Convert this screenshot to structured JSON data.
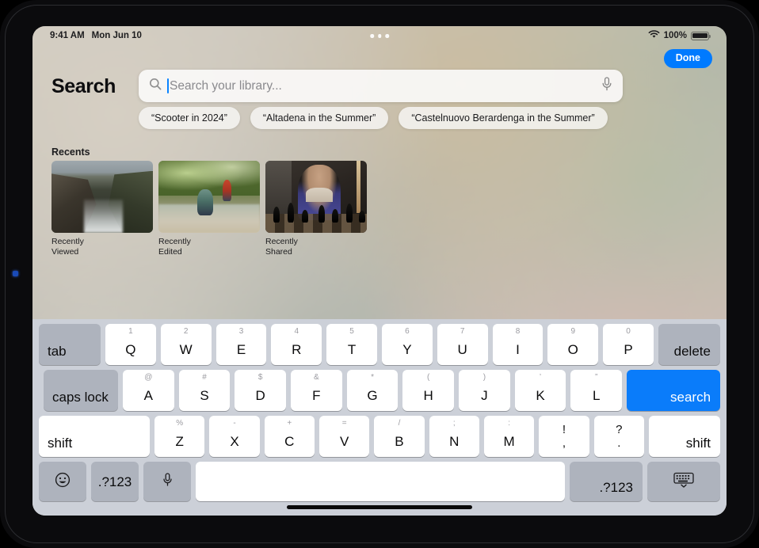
{
  "status_bar": {
    "time": "9:41 AM",
    "date": "Mon Jun 10",
    "battery_percent": "100%",
    "wifi_icon": "wifi-icon",
    "battery_icon": "battery-icon",
    "multitask_icon": "multitasking-dots-icon"
  },
  "header": {
    "title": "Search",
    "done_label": "Done"
  },
  "search": {
    "placeholder": "Search your library...",
    "value": "",
    "search_icon": "search-icon",
    "mic_icon": "microphone-icon"
  },
  "suggestions": [
    {
      "label": "“Scooter in 2024”"
    },
    {
      "label": "“Altadena in the Summer”"
    },
    {
      "label": "“Castelnuovo Berardenga in the Summer”"
    }
  ],
  "recents": {
    "section_title": "Recents",
    "items": [
      {
        "caption": "Recently Viewed",
        "thumb": "coastal-cliffs-photo"
      },
      {
        "caption": "Recently Edited",
        "thumb": "stream-hikers-photo"
      },
      {
        "caption": "Recently Shared",
        "thumb": "chess-player-photo"
      }
    ]
  },
  "keyboard": {
    "row1": [
      {
        "main": "tab",
        "sup": "",
        "style": "dark",
        "size": "k-tab",
        "align": "label-bl"
      },
      {
        "main": "Q",
        "sup": "1"
      },
      {
        "main": "W",
        "sup": "2"
      },
      {
        "main": "E",
        "sup": "3"
      },
      {
        "main": "R",
        "sup": "4"
      },
      {
        "main": "T",
        "sup": "5"
      },
      {
        "main": "Y",
        "sup": "6"
      },
      {
        "main": "U",
        "sup": "7"
      },
      {
        "main": "I",
        "sup": "8"
      },
      {
        "main": "O",
        "sup": "9"
      },
      {
        "main": "P",
        "sup": "0"
      },
      {
        "main": "delete",
        "sup": "",
        "style": "dark",
        "size": "k-del",
        "align": "label-br"
      }
    ],
    "row2": [
      {
        "main": "caps lock",
        "sup": "",
        "style": "dark",
        "size": "k-caps",
        "align": "label-bl"
      },
      {
        "main": "A",
        "sup": "@"
      },
      {
        "main": "S",
        "sup": "#"
      },
      {
        "main": "D",
        "sup": "$"
      },
      {
        "main": "F",
        "sup": "&"
      },
      {
        "main": "G",
        "sup": "*"
      },
      {
        "main": "H",
        "sup": "("
      },
      {
        "main": "J",
        "sup": ")"
      },
      {
        "main": "K",
        "sup": "’"
      },
      {
        "main": "L",
        "sup": "”"
      },
      {
        "main": "search",
        "sup": "",
        "style": "blue",
        "size": "k-search",
        "align": "label-br"
      }
    ],
    "row3": [
      {
        "main": "shift",
        "sup": "",
        "size": "k-shift-l",
        "align": "label-bl"
      },
      {
        "main": "Z",
        "sup": "%"
      },
      {
        "main": "X",
        "sup": "-"
      },
      {
        "main": "C",
        "sup": "+"
      },
      {
        "main": "V",
        "sup": "="
      },
      {
        "main": "B",
        "sup": "/"
      },
      {
        "main": "N",
        "sup": ";"
      },
      {
        "main": "M",
        "sup": ":"
      },
      {
        "top": "!",
        "bot": ",",
        "dual": true
      },
      {
        "top": "?",
        "bot": ".",
        "dual": true
      },
      {
        "main": "shift",
        "sup": "",
        "size": "k-shift-r",
        "align": "label-br"
      }
    ],
    "row4": [
      {
        "main": "☺",
        "icon": "emoji-icon",
        "style": "dark",
        "size": "k-emoji"
      },
      {
        "main": ".?123",
        "style": "dark",
        "size": "k-num-l"
      },
      {
        "main": "⬤",
        "icon": "microphone-icon",
        "style": "dark",
        "size": "k-mic"
      },
      {
        "main": "",
        "icon": "spacebar",
        "size": "k-space"
      },
      {
        "main": ".?123",
        "style": "dark",
        "size": "k-num-r",
        "align": "label-br"
      },
      {
        "main": "",
        "icon": "hide-keyboard-icon",
        "style": "dark",
        "size": "k-hide"
      }
    ]
  },
  "colors": {
    "accent_blue": "#007aff",
    "key_blue": "#0a7cfa",
    "keyboard_bg": "#ccd0d8",
    "key_white": "#ffffff",
    "key_dark": "#aeb3bd"
  }
}
